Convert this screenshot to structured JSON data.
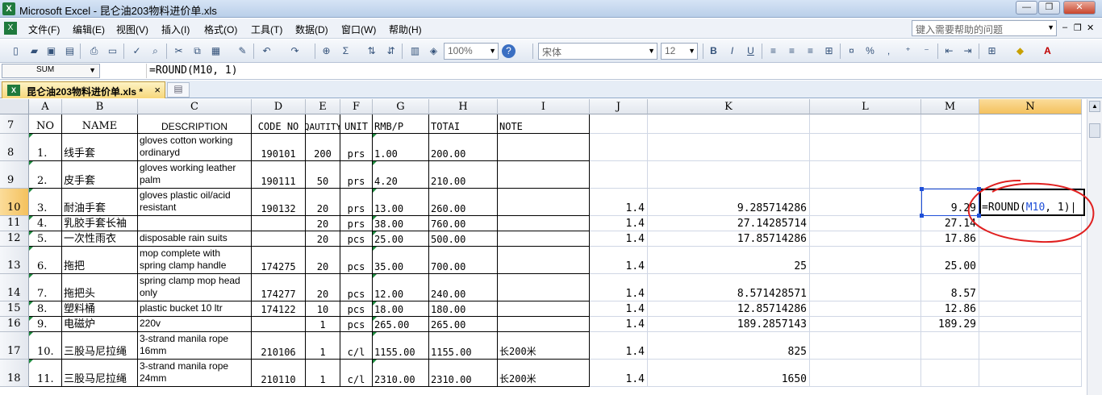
{
  "window": {
    "title": "Microsoft Excel - 昆仑油203物料进价单.xls",
    "min_icon": "minimize-icon",
    "max_icon": "restore-icon",
    "close_icon": "close-icon"
  },
  "menubar": {
    "items": [
      "文件(F)",
      "编辑(E)",
      "视图(V)",
      "插入(I)",
      "格式(O)",
      "工具(T)",
      "数据(D)",
      "窗口(W)",
      "帮助(H)"
    ],
    "help_placeholder": "键入需要帮助的问题"
  },
  "toolbar": {
    "zoom": "100%",
    "font": "宋体",
    "size": "12",
    "sum_icon": "Σ",
    "bold": "B",
    "italic": "I",
    "underline": "U",
    "percent": "%"
  },
  "formula_bar": {
    "name_box": "SUM",
    "formula": "=ROUND(M10, 1)"
  },
  "document_tab": {
    "label": "昆仑油203物料进价单.xls *",
    "close": "×"
  },
  "columns": [
    "A",
    "B",
    "C",
    "D",
    "E",
    "F",
    "G",
    "H",
    "I",
    "J",
    "K",
    "L",
    "M",
    "N"
  ],
  "rows": [
    {
      "num": "7",
      "A": "NO",
      "B": "NAME",
      "C": "DESCRIPTION",
      "D": "CODE NO",
      "E": "QAUTITY",
      "F": "UNIT",
      "G": "RMB/P",
      "H": "TOTAI",
      "I": "NOTE",
      "J": "",
      "K": "",
      "M": ""
    },
    {
      "num": "8",
      "A": "1.",
      "B": "线手套",
      "C": "gloves cotton working ordinaryd",
      "D": "190101",
      "E": "200",
      "F": "prs",
      "G": "1.00",
      "H": "200.00",
      "I": "",
      "J": "",
      "K": "",
      "M": ""
    },
    {
      "num": "9",
      "A": "2.",
      "B": "皮手套",
      "C": "gloves  working leather palm",
      "D": "190111",
      "E": "50",
      "F": "prs",
      "G": "4.20",
      "H": "210.00",
      "I": "",
      "J": "",
      "K": "",
      "M": ""
    },
    {
      "num": "10",
      "A": "3.",
      "B": "耐油手套",
      "C": "gloves plastic oil/acid resistant",
      "D": "190132",
      "E": "20",
      "F": "prs",
      "G": "13.00",
      "H": "260.00",
      "I": "",
      "J": "1.4",
      "K": "9.285714286",
      "M": "9.29"
    },
    {
      "num": "11",
      "A": "4.",
      "B": "乳胶手套长袖",
      "C": "",
      "D": "",
      "E": "20",
      "F": "prs",
      "G": "38.00",
      "H": "760.00",
      "I": "",
      "J": "1.4",
      "K": "27.14285714",
      "M": "27.14"
    },
    {
      "num": "12",
      "A": "5.",
      "B": "一次性雨衣",
      "C": "disposable rain suits",
      "D": "",
      "E": "20",
      "F": "pcs",
      "G": "25.00",
      "H": "500.00",
      "I": "",
      "J": "1.4",
      "K": "17.85714286",
      "M": "17.86"
    },
    {
      "num": "13",
      "A": "6.",
      "B": "拖把",
      "C": "mop complete with spring clamp handle",
      "D": "174275",
      "E": "20",
      "F": "pcs",
      "G": "35.00",
      "H": "700.00",
      "I": "",
      "J": "1.4",
      "K": "25",
      "M": "25.00"
    },
    {
      "num": "14",
      "A": "7.",
      "B": "拖把头",
      "C": " spring clamp mop head only",
      "D": "174277",
      "E": "20",
      "F": "pcs",
      "G": "12.00",
      "H": "240.00",
      "I": "",
      "J": "1.4",
      "K": "8.571428571",
      "M": "8.57"
    },
    {
      "num": "15",
      "A": "8.",
      "B": "塑料桶",
      "C": "plastic bucket 10 ltr",
      "D": "174122",
      "E": "10",
      "F": "pcs",
      "G": "18.00",
      "H": "180.00",
      "I": "",
      "J": "1.4",
      "K": "12.85714286",
      "M": "12.86"
    },
    {
      "num": "16",
      "A": "9.",
      "B": "电磁炉",
      "C": "220v",
      "D": "",
      "E": "1",
      "F": "pcs",
      "G": "265.00",
      "H": "265.00",
      "I": "",
      "J": "1.4",
      "K": "189.2857143",
      "M": "189.29"
    },
    {
      "num": "17",
      "A": "10.",
      "B": "三股马尼拉绳",
      "C": "3-strand manila rope 16mm",
      "D": "210106",
      "E": "1",
      "F": "c/l",
      "G": "1155.00",
      "H": "1155.00",
      "I": "长200米",
      "J": "1.4",
      "K": "825",
      "M": ""
    },
    {
      "num": "18",
      "A": "11.",
      "B": "三股马尼拉绳",
      "C": "3-strand manila rope 24mm",
      "D": "210110",
      "E": "1",
      "F": "c/l",
      "G": "2310.00",
      "H": "2310.00",
      "I": "长200米",
      "J": "1.4",
      "K": "1650",
      "M": ""
    }
  ],
  "active_cell": {
    "ref": "N10",
    "prefix": "=ROUND(",
    "arg": "M10",
    "suffix": ", 1)"
  },
  "annotation_color": "#e02020"
}
